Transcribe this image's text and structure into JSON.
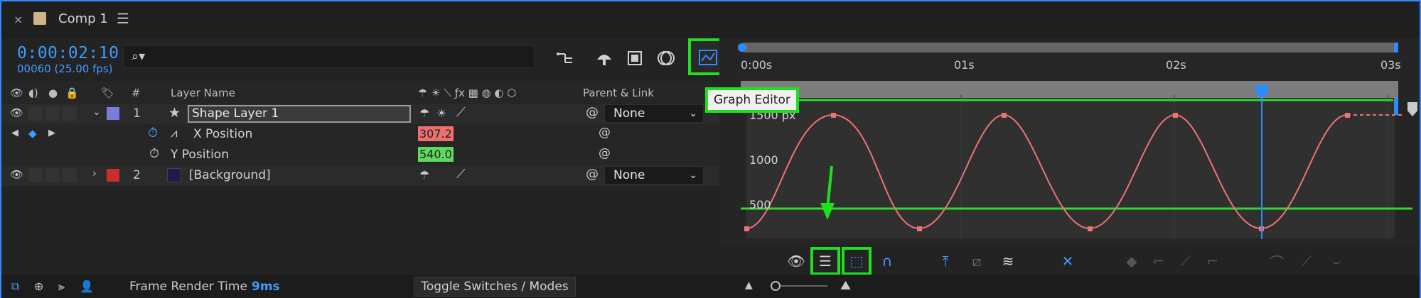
{
  "tab": {
    "title": "Comp 1",
    "close": "×",
    "menu": "☰"
  },
  "timecode": "0:00:02:10",
  "fps": "00060 (25.00 fps)",
  "search": {
    "placeholder": ""
  },
  "columns": {
    "layer_name": "Layer Name",
    "number": "#",
    "parent_link": "Parent & Link"
  },
  "layers": [
    {
      "num": "1",
      "name": "Shape Layer 1",
      "label_color": "#7b7bdc",
      "parent": "None"
    },
    {
      "num": "2",
      "name": "[Background]",
      "label_color": "#c82e2e",
      "parent": "None"
    }
  ],
  "properties": [
    {
      "name": "X Position",
      "value": "307.2"
    },
    {
      "name": "Y Position",
      "value": "540.0"
    }
  ],
  "tooltip": "Graph Editor",
  "time_ruler": [
    "0:00s",
    "01s",
    "02s",
    "03s"
  ],
  "graph": {
    "y_labels": [
      "1500 px",
      "1000",
      "500"
    ],
    "curve_color": "#f07373",
    "playhead_color": "#2d8cff",
    "guide_color": "#2fd82f"
  },
  "status": {
    "frame_render_label": "Frame Render Time",
    "frame_render_value": "9ms",
    "toggle_label": "Toggle Switches / Modes"
  },
  "colors": {
    "accent": "#2d8cff",
    "highlight": "#1ee01e"
  }
}
